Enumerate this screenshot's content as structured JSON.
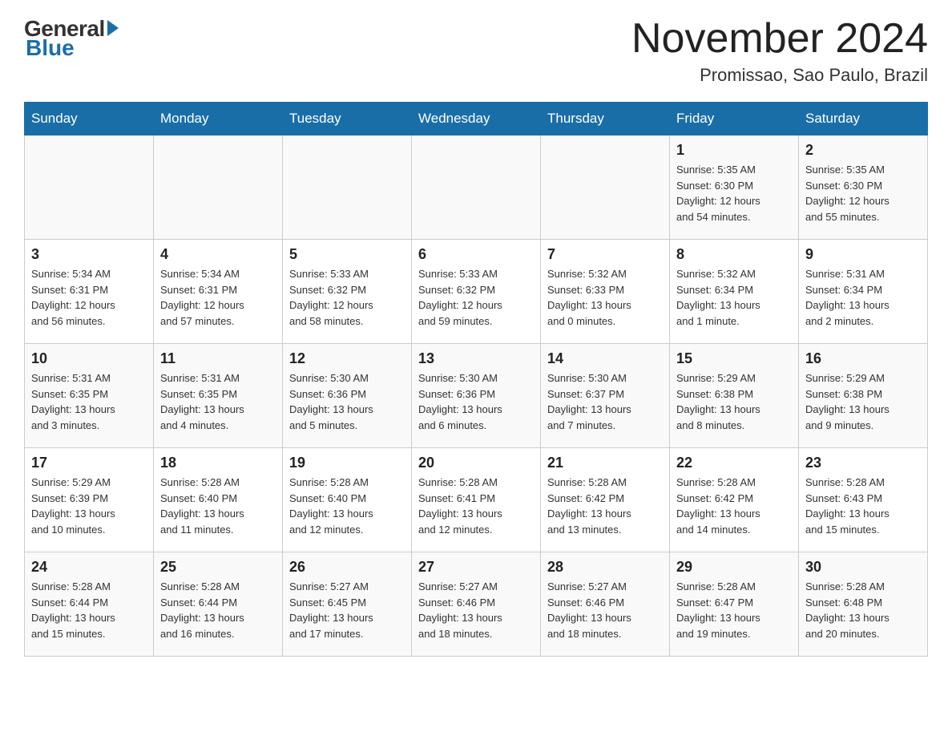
{
  "header": {
    "logo_general": "General",
    "logo_blue": "Blue",
    "month_title": "November 2024",
    "location": "Promissao, Sao Paulo, Brazil"
  },
  "weekdays": [
    "Sunday",
    "Monday",
    "Tuesday",
    "Wednesday",
    "Thursday",
    "Friday",
    "Saturday"
  ],
  "weeks": [
    [
      {
        "day": "",
        "info": ""
      },
      {
        "day": "",
        "info": ""
      },
      {
        "day": "",
        "info": ""
      },
      {
        "day": "",
        "info": ""
      },
      {
        "day": "",
        "info": ""
      },
      {
        "day": "1",
        "info": "Sunrise: 5:35 AM\nSunset: 6:30 PM\nDaylight: 12 hours\nand 54 minutes."
      },
      {
        "day": "2",
        "info": "Sunrise: 5:35 AM\nSunset: 6:30 PM\nDaylight: 12 hours\nand 55 minutes."
      }
    ],
    [
      {
        "day": "3",
        "info": "Sunrise: 5:34 AM\nSunset: 6:31 PM\nDaylight: 12 hours\nand 56 minutes."
      },
      {
        "day": "4",
        "info": "Sunrise: 5:34 AM\nSunset: 6:31 PM\nDaylight: 12 hours\nand 57 minutes."
      },
      {
        "day": "5",
        "info": "Sunrise: 5:33 AM\nSunset: 6:32 PM\nDaylight: 12 hours\nand 58 minutes."
      },
      {
        "day": "6",
        "info": "Sunrise: 5:33 AM\nSunset: 6:32 PM\nDaylight: 12 hours\nand 59 minutes."
      },
      {
        "day": "7",
        "info": "Sunrise: 5:32 AM\nSunset: 6:33 PM\nDaylight: 13 hours\nand 0 minutes."
      },
      {
        "day": "8",
        "info": "Sunrise: 5:32 AM\nSunset: 6:34 PM\nDaylight: 13 hours\nand 1 minute."
      },
      {
        "day": "9",
        "info": "Sunrise: 5:31 AM\nSunset: 6:34 PM\nDaylight: 13 hours\nand 2 minutes."
      }
    ],
    [
      {
        "day": "10",
        "info": "Sunrise: 5:31 AM\nSunset: 6:35 PM\nDaylight: 13 hours\nand 3 minutes."
      },
      {
        "day": "11",
        "info": "Sunrise: 5:31 AM\nSunset: 6:35 PM\nDaylight: 13 hours\nand 4 minutes."
      },
      {
        "day": "12",
        "info": "Sunrise: 5:30 AM\nSunset: 6:36 PM\nDaylight: 13 hours\nand 5 minutes."
      },
      {
        "day": "13",
        "info": "Sunrise: 5:30 AM\nSunset: 6:36 PM\nDaylight: 13 hours\nand 6 minutes."
      },
      {
        "day": "14",
        "info": "Sunrise: 5:30 AM\nSunset: 6:37 PM\nDaylight: 13 hours\nand 7 minutes."
      },
      {
        "day": "15",
        "info": "Sunrise: 5:29 AM\nSunset: 6:38 PM\nDaylight: 13 hours\nand 8 minutes."
      },
      {
        "day": "16",
        "info": "Sunrise: 5:29 AM\nSunset: 6:38 PM\nDaylight: 13 hours\nand 9 minutes."
      }
    ],
    [
      {
        "day": "17",
        "info": "Sunrise: 5:29 AM\nSunset: 6:39 PM\nDaylight: 13 hours\nand 10 minutes."
      },
      {
        "day": "18",
        "info": "Sunrise: 5:28 AM\nSunset: 6:40 PM\nDaylight: 13 hours\nand 11 minutes."
      },
      {
        "day": "19",
        "info": "Sunrise: 5:28 AM\nSunset: 6:40 PM\nDaylight: 13 hours\nand 12 minutes."
      },
      {
        "day": "20",
        "info": "Sunrise: 5:28 AM\nSunset: 6:41 PM\nDaylight: 13 hours\nand 12 minutes."
      },
      {
        "day": "21",
        "info": "Sunrise: 5:28 AM\nSunset: 6:42 PM\nDaylight: 13 hours\nand 13 minutes."
      },
      {
        "day": "22",
        "info": "Sunrise: 5:28 AM\nSunset: 6:42 PM\nDaylight: 13 hours\nand 14 minutes."
      },
      {
        "day": "23",
        "info": "Sunrise: 5:28 AM\nSunset: 6:43 PM\nDaylight: 13 hours\nand 15 minutes."
      }
    ],
    [
      {
        "day": "24",
        "info": "Sunrise: 5:28 AM\nSunset: 6:44 PM\nDaylight: 13 hours\nand 15 minutes."
      },
      {
        "day": "25",
        "info": "Sunrise: 5:28 AM\nSunset: 6:44 PM\nDaylight: 13 hours\nand 16 minutes."
      },
      {
        "day": "26",
        "info": "Sunrise: 5:27 AM\nSunset: 6:45 PM\nDaylight: 13 hours\nand 17 minutes."
      },
      {
        "day": "27",
        "info": "Sunrise: 5:27 AM\nSunset: 6:46 PM\nDaylight: 13 hours\nand 18 minutes."
      },
      {
        "day": "28",
        "info": "Sunrise: 5:27 AM\nSunset: 6:46 PM\nDaylight: 13 hours\nand 18 minutes."
      },
      {
        "day": "29",
        "info": "Sunrise: 5:28 AM\nSunset: 6:47 PM\nDaylight: 13 hours\nand 19 minutes."
      },
      {
        "day": "30",
        "info": "Sunrise: 5:28 AM\nSunset: 6:48 PM\nDaylight: 13 hours\nand 20 minutes."
      }
    ]
  ]
}
